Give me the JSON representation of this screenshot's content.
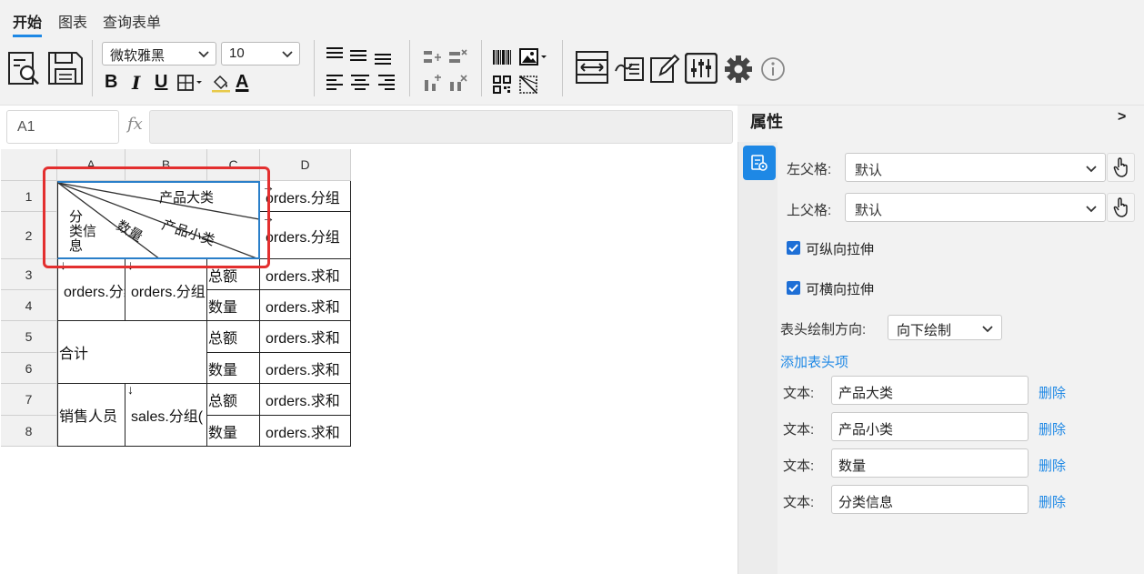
{
  "tabs": [
    "开始",
    "图表",
    "查询表单"
  ],
  "toolbar": {
    "font_family": "微软雅黑",
    "font_size": "10",
    "bold_label": "B",
    "italic_label": "I",
    "underline_label": "U",
    "font_color_label": "A",
    "icons": [
      "preview-icon",
      "save-icon",
      "border-icon",
      "fill-color-icon",
      "align-top-icon",
      "align-middle-icon",
      "align-bottom-icon",
      "align-left-icon",
      "align-center-icon",
      "align-right-icon",
      "insert-row-icon",
      "delete-row-icon",
      "insert-col-icon",
      "delete-col-icon",
      "barcode-icon",
      "image-icon",
      "qrcode-icon",
      "slash-header-icon",
      "layout-icon",
      "sign-icon",
      "edit-icon",
      "sliders-icon",
      "gear-icon",
      "info-icon"
    ]
  },
  "formula_bar": {
    "cell_ref": "A1",
    "fx": "fx"
  },
  "grid": {
    "columns": [
      "A",
      "B",
      "C",
      "D"
    ],
    "rows": [
      "1",
      "2",
      "3",
      "4",
      "5",
      "6",
      "7",
      "8"
    ],
    "header_cell": {
      "text_product_category": "产品大类",
      "text_product_subcategory": "产品小类",
      "text_quantity": "数量",
      "text_category_info_line1": "分",
      "text_category_info_line2": "类信",
      "text_category_info_line3": "息"
    },
    "arrow_right": "→",
    "arrow_down": "↓",
    "d1": "orders.分组",
    "d2": "orders.分组",
    "a3": "orders.分组",
    "b3": "orders.分组",
    "c3": "总额",
    "d3": "orders.求和",
    "c4": "数量",
    "d4": "orders.求和",
    "a5": "合计",
    "c5": "总额",
    "d5": "orders.求和",
    "c6": "数量",
    "d6": "orders.求和",
    "a7": "销售人员",
    "b7": "sales.分组(",
    "c7": "总额",
    "d7": "orders.求和",
    "c8": "数量",
    "d8": "orders.求和"
  },
  "properties": {
    "title": "属性",
    "collapse": ">",
    "left_parent_label": "左父格:",
    "left_parent_value": "默认",
    "top_parent_label": "上父格:",
    "top_parent_value": "默认",
    "vertical_stretch_label": "可纵向拉伸",
    "horizontal_stretch_label": "可横向拉伸",
    "vertical_stretch": true,
    "horizontal_stretch": true,
    "draw_direction_label": "表头绘制方向:",
    "draw_direction_value": "向下绘制",
    "add_header_item": "添加表头项",
    "header_items": [
      {
        "label": "文本:",
        "value": "产品大类",
        "delete": "删除"
      },
      {
        "label": "文本:",
        "value": "产品小类",
        "delete": "删除"
      },
      {
        "label": "文本:",
        "value": "数量",
        "delete": "删除"
      },
      {
        "label": "文本:",
        "value": "分类信息",
        "delete": "删除"
      }
    ]
  },
  "colors": {
    "accent": "#1e88e5",
    "highlight": "#e32f2f"
  }
}
